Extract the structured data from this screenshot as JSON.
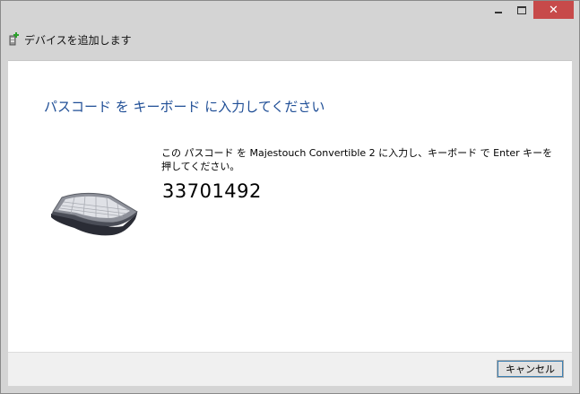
{
  "window": {
    "title": "デバイスを追加します",
    "caption": {
      "minimize_icon": "minimize-icon",
      "maximize_icon": "maximize-icon",
      "close_glyph": "✕"
    }
  },
  "main": {
    "heading": "パスコード を キーボード に入力してください",
    "instruction": "この パスコード を Majestouch Convertible 2 に入力し、キーボード で Enter キーを押してください。",
    "passcode": "33701492",
    "device_icon": "keyboard-icon"
  },
  "footer": {
    "cancel_label": "キャンセル"
  },
  "colors": {
    "heading": "#1f4e96",
    "close_button": "#c74a4a",
    "client_bg": "#ffffff",
    "frame_bg": "#d4d4d4"
  }
}
